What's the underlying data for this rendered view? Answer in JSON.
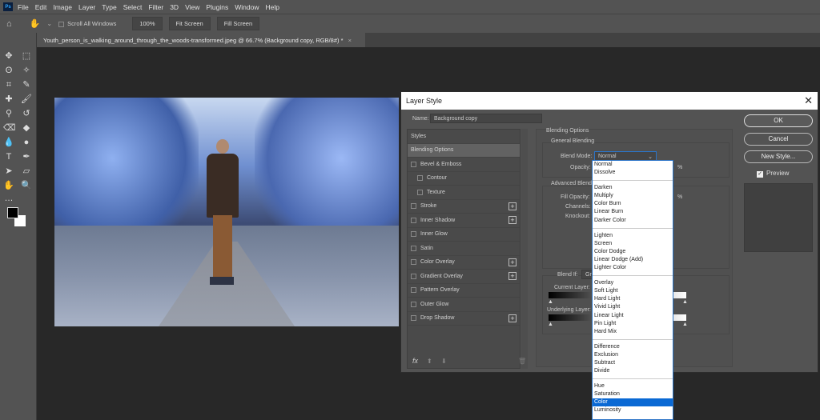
{
  "app": {
    "logo": "Ps",
    "menu": [
      "File",
      "Edit",
      "Image",
      "Layer",
      "Type",
      "Select",
      "Filter",
      "3D",
      "View",
      "Plugins",
      "Window",
      "Help"
    ]
  },
  "options": {
    "scroll_all": "Scroll All Windows",
    "zoom_100": "100%",
    "fit_screen": "Fit Screen",
    "fill_screen": "Fill Screen"
  },
  "document_tab": {
    "title": "Youth_person_is_walking_around_through_the_woods-transformed.jpeg @ 66.7% (Background copy, RGB/8#) *",
    "close": "×"
  },
  "dialog": {
    "title": "Layer Style",
    "close": "✕",
    "name_label": "Name:",
    "name_value": "Background copy",
    "styles": [
      {
        "label": "Styles",
        "check": false,
        "plus": false,
        "indent": false,
        "header": true
      },
      {
        "label": "Blending Options",
        "check": false,
        "plus": false,
        "selected": true
      },
      {
        "label": "Bevel & Emboss",
        "check": true,
        "plus": false
      },
      {
        "label": "Contour",
        "check": true,
        "plus": false,
        "indent": true
      },
      {
        "label": "Texture",
        "check": true,
        "plus": false,
        "indent": true
      },
      {
        "label": "Stroke",
        "check": true,
        "plus": true
      },
      {
        "label": "Inner Shadow",
        "check": true,
        "plus": true
      },
      {
        "label": "Inner Glow",
        "check": true,
        "plus": false
      },
      {
        "label": "Satin",
        "check": true,
        "plus": false
      },
      {
        "label": "Color Overlay",
        "check": true,
        "plus": true
      },
      {
        "label": "Gradient Overlay",
        "check": true,
        "plus": true
      },
      {
        "label": "Pattern Overlay",
        "check": true,
        "plus": false
      },
      {
        "label": "Outer Glow",
        "check": true,
        "plus": false
      },
      {
        "label": "Drop Shadow",
        "check": true,
        "plus": true
      }
    ],
    "fx": "fx",
    "blending": {
      "title": "Blending Options",
      "general": "General Blending",
      "blend_mode_label": "Blend Mode:",
      "blend_mode_value": "Normal",
      "opacity_label": "Opacity:",
      "pct": "%",
      "advanced": "Advanced Blending",
      "fill_opacity_label": "Fill Opacity:",
      "channels_label": "Channels:",
      "knockout_label": "Knockout:",
      "blend_if_label": "Blend If:",
      "blend_if_value": "Gra",
      "current_layer": "Current Layer:",
      "underlying_layer": "Underlying Layer:"
    },
    "buttons": {
      "ok": "OK",
      "cancel": "Cancel",
      "new_style": "New Style...",
      "preview": "Preview"
    },
    "preview_checked": true
  },
  "blend_modes": [
    [
      "Normal",
      "Dissolve"
    ],
    [
      "Darken",
      "Multiply",
      "Color Burn",
      "Linear Burn",
      "Darker Color"
    ],
    [
      "Lighten",
      "Screen",
      "Color Dodge",
      "Linear Dodge (Add)",
      "Lighter Color"
    ],
    [
      "Overlay",
      "Soft Light",
      "Hard Light",
      "Vivid Light",
      "Linear Light",
      "Pin Light",
      "Hard Mix"
    ],
    [
      "Difference",
      "Exclusion",
      "Subtract",
      "Divide"
    ],
    [
      "Hue",
      "Saturation",
      "Color",
      "Luminosity"
    ]
  ],
  "highlighted_mode": "Color",
  "colors": {
    "accent": "#0a69d4",
    "foreground": "#000000",
    "background": "#ffffff"
  }
}
